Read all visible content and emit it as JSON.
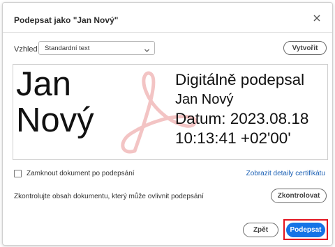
{
  "dialog": {
    "title": "Podepsat jako \"Jan Nový\""
  },
  "appearance": {
    "label": "Vzhled",
    "selected": "Standardní text",
    "create_label": "Vytvořit"
  },
  "signature": {
    "name_line1": "Jan",
    "name_line2": "Nový",
    "detail_line1": "Digitálně podepsal",
    "detail_line2": "Jan Nový",
    "detail_line3": "Datum: 2023.08.18",
    "detail_line4": "10:13:41 +02'00'"
  },
  "options": {
    "lock_label": "Zamknout dokument po podepsání",
    "lock_checked": false,
    "cert_link": "Zobrazit detaily certifikátu"
  },
  "review": {
    "text": "Zkontrolujte obsah dokumentu, který může ovlivnit podepsání",
    "button_label": "Zkontrolovat"
  },
  "footer": {
    "back_label": "Zpět",
    "sign_label": "Podepsat"
  },
  "colors": {
    "accent": "#1473e6",
    "highlight": "#e3121d",
    "link": "#1a5fb4",
    "watermark": "#f3c4c4"
  }
}
